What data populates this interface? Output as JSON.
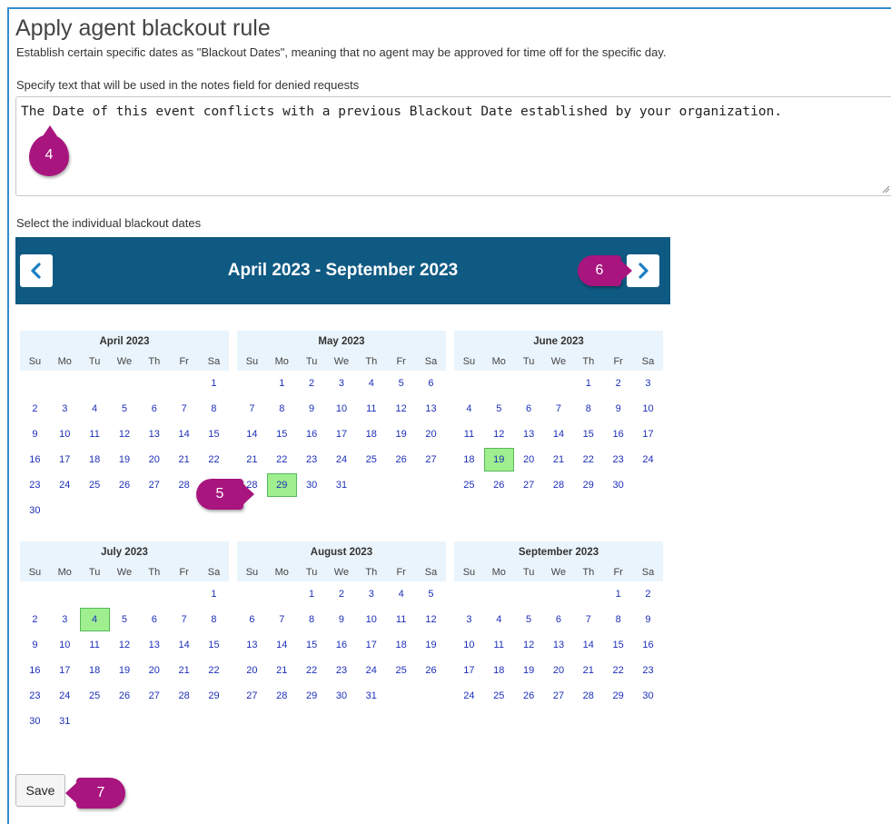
{
  "page": {
    "title": "Apply agent blackout rule",
    "subtitle": "Establish certain specific dates as \"Blackout Dates\", meaning that no agent may be approved for time off for the specific day.",
    "notes_label": "Specify text that will be used in the notes field for denied requests",
    "notes_value": "The Date of this event conflicts with a previous Blackout Date established by your organization.",
    "dates_label": "Select the individual blackout dates",
    "save_label": "Save"
  },
  "calendar": {
    "range_title": "April 2023 - September 2023",
    "prev_icon": "chevron-left-icon",
    "next_icon": "chevron-right-icon",
    "weekdays": [
      "Su",
      "Mo",
      "Tu",
      "We",
      "Th",
      "Fr",
      "Sa"
    ],
    "months": [
      {
        "name": "April 2023",
        "first_weekday": 6,
        "days": 30,
        "selected": []
      },
      {
        "name": "May 2023",
        "first_weekday": 1,
        "days": 31,
        "selected": [
          29
        ]
      },
      {
        "name": "June 2023",
        "first_weekday": 4,
        "days": 30,
        "selected": [
          19
        ]
      },
      {
        "name": "July 2023",
        "first_weekday": 6,
        "days": 31,
        "selected": [
          4
        ]
      },
      {
        "name": "August 2023",
        "first_weekday": 2,
        "days": 31,
        "selected": []
      },
      {
        "name": "September 2023",
        "first_weekday": 5,
        "days": 30,
        "selected": []
      }
    ],
    "selected_color": "#9fef8e",
    "header_color": "#0f5a83"
  },
  "callouts": {
    "c4": "4",
    "c5": "5",
    "c6": "6",
    "c7": "7"
  },
  "colors": {
    "accent": "#a8157e",
    "day_link": "#1d2fb8"
  }
}
